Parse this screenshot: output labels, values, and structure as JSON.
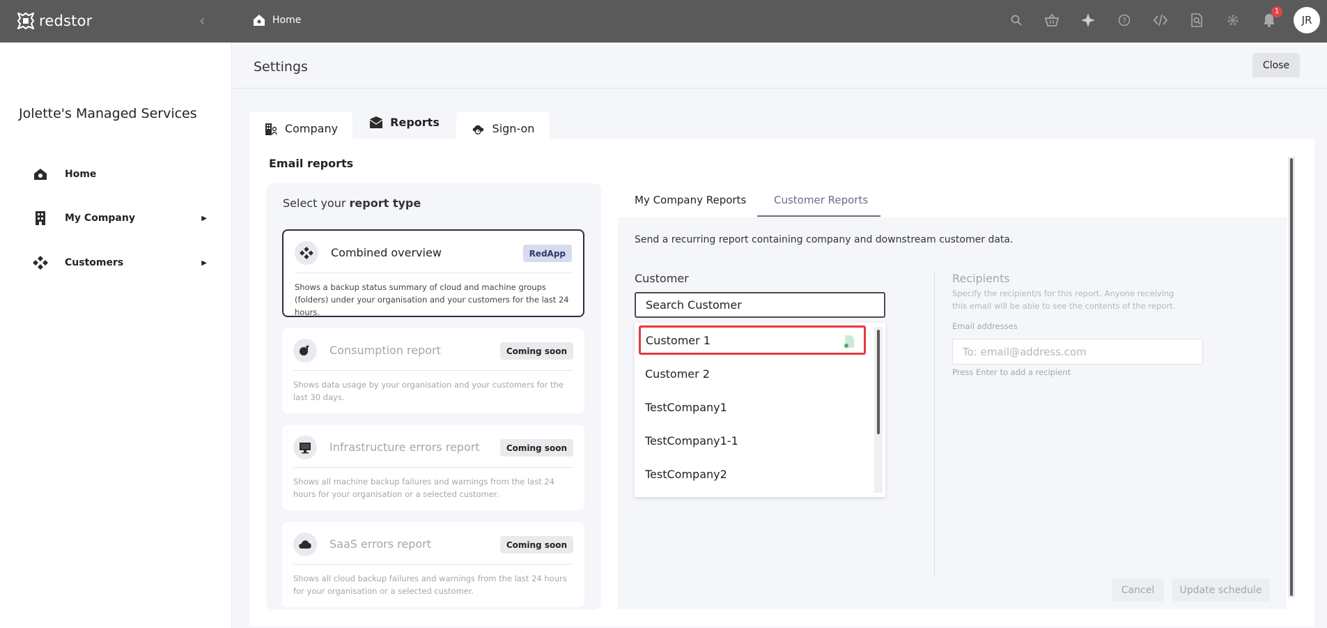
{
  "topbar": {
    "brand_name": "redstor",
    "collapse_icon": "chevron-left-icon",
    "breadcrumb": "Home",
    "icons": [
      "search-icon",
      "basket-icon",
      "sparkle-icon",
      "help-icon",
      "code-icon",
      "search-document-icon",
      "gear-icon",
      "bell-icon"
    ],
    "notification_count": "1",
    "avatar_initials": "JR"
  },
  "sidebar": {
    "org_name": "Jolette's Managed Services",
    "items": [
      {
        "label": "Home",
        "icon": "home-icon"
      },
      {
        "label": "My Company",
        "icon": "building-icon",
        "arrow": "▶"
      },
      {
        "label": "Customers",
        "icon": "diamond-cluster-icon",
        "arrow": "▶"
      }
    ]
  },
  "settings": {
    "title": "Settings",
    "close_label": "Close",
    "tabs": [
      {
        "label": "Company",
        "icon": "company-icon"
      },
      {
        "label": "Reports",
        "icon": "envelope-icon"
      },
      {
        "label": "Sign-on",
        "icon": "cloud-key-icon"
      }
    ],
    "active_tab": "Reports"
  },
  "email_reports": {
    "title": "Email reports",
    "select_prefix": "Select your ",
    "select_bold": "report type",
    "report_types": [
      {
        "title": "Combined overview",
        "badge": "RedApp",
        "desc": "Shows a backup status summary of cloud and machine groups (folders) under your organisation and your customers for the last 24 hours.",
        "icon": "diamond-cluster-icon"
      },
      {
        "title": "Consumption report",
        "badge": "Coming soon",
        "desc": "Shows data usage by your organisation and your customers for the last 30 days.",
        "icon": "consumption-icon"
      },
      {
        "title": "Infrastructure errors report",
        "badge": "Coming soon",
        "desc": "Shows all machine backup failures and warnings from the last 24 hours for your organisation or a selected customer.",
        "icon": "monitor-icon"
      },
      {
        "title": "SaaS errors report",
        "badge": "Coming soon",
        "desc": "Shows all cloud backup failures and warnings from the last 24 hours for your organisation or a selected customer.",
        "icon": "cloud-icon"
      }
    ]
  },
  "customer_reports": {
    "tabs": [
      {
        "label": "My Company Reports"
      },
      {
        "label": "Customer Reports"
      }
    ],
    "active_tab": "Customer Reports",
    "intro": "Send a recurring report containing company and downstream customer data.",
    "customer_label": "Customer",
    "search_value": "Search Customer",
    "dropdown_items": [
      {
        "label": "Customer 1"
      },
      {
        "label": "Customer 2"
      },
      {
        "label": "TestCompany1"
      },
      {
        "label": "TestCompany1-1"
      },
      {
        "label": "TestCompany2"
      }
    ],
    "highlighted_item": "Customer 1",
    "recipients_title": "Recipients",
    "recipients_help": "Specify the recipient/s for this report. Anyone receiving this email will be able to see the contents of the report.",
    "email_label": "Email addresses",
    "email_placeholder": "To: email@address.com",
    "enter_hint": "Press Enter to add a recipient",
    "cancel_label": "Cancel",
    "update_label": "Update schedule"
  },
  "colors": {
    "topbar": "#5a5a5a",
    "highlight_border": "#e23a3f",
    "tab_accent": "#6b6e86",
    "redapp_badge": "#d6dbf0"
  }
}
